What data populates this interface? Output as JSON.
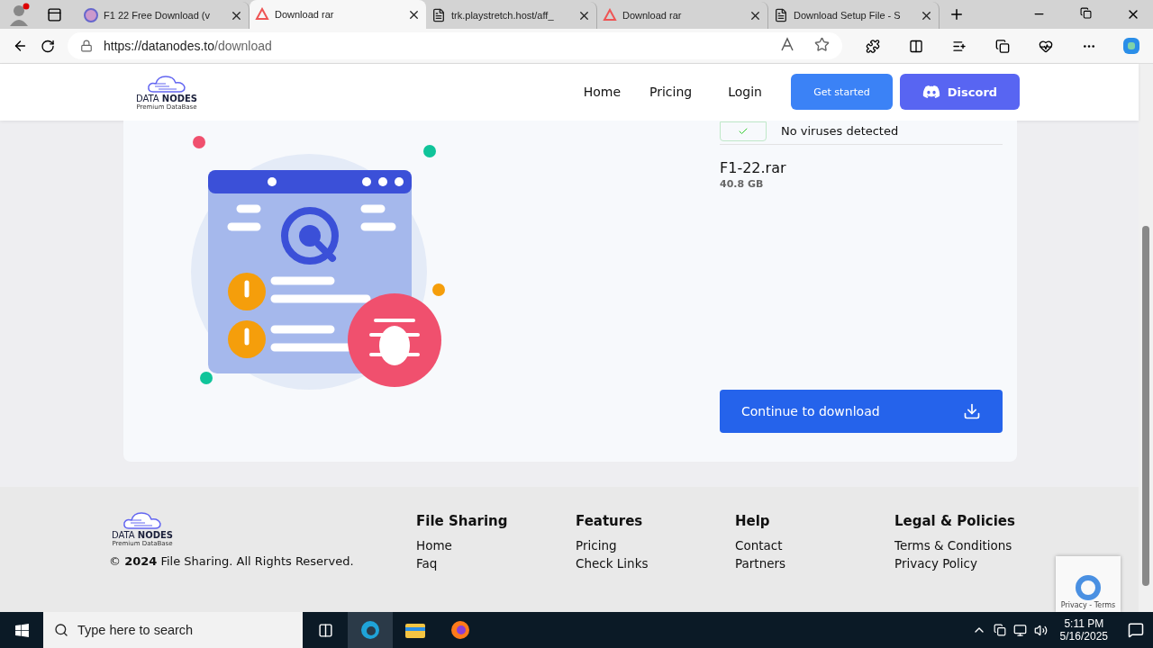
{
  "browser": {
    "tabs": [
      {
        "title": "F1 22 Free Download (v",
        "selected": false,
        "kind": "site"
      },
      {
        "title": "Download rar",
        "selected": true,
        "kind": "rar"
      },
      {
        "title": "trk.playstretch.host/aff_",
        "selected": false,
        "kind": "page"
      },
      {
        "title": "Download rar",
        "selected": false,
        "kind": "rar"
      },
      {
        "title": "Download Setup File - S",
        "selected": false,
        "kind": "page"
      }
    ],
    "address": {
      "host": "https://datanodes.to",
      "path": "/download"
    }
  },
  "header": {
    "logo": {
      "name": "DATA **NODES**",
      "tagline": "Premium DataBase"
    },
    "nav": [
      "Home",
      "Pricing",
      "Login"
    ],
    "get_started": "Get started",
    "discord": "Discord"
  },
  "file_card": {
    "scan_status": "No viruses detected",
    "file_name": "F1-22.rar",
    "file_size": "40.8 GB",
    "download_button": "Continue to download"
  },
  "footer": {
    "logo": {
      "name": "DATA **NODES**",
      "tagline": "Premium DataBase"
    },
    "copyright": "© **2024** File Sharing. All Rights Reserved.",
    "columns": [
      {
        "heading": "File Sharing",
        "links": [
          "Home",
          "Faq"
        ]
      },
      {
        "heading": "Features",
        "links": [
          "Pricing",
          "Check Links"
        ]
      },
      {
        "heading": "Help",
        "links": [
          "Contact",
          "Partners"
        ]
      },
      {
        "heading": "Legal & Policies",
        "links": [
          "Terms & Conditions",
          "Privacy Policy"
        ]
      }
    ],
    "recaptcha": "Privacy - Terms"
  },
  "taskbar": {
    "search": {
      "placeholder": "Type here to search"
    },
    "time": "5:11 PM",
    "date": "5/16/2025"
  }
}
